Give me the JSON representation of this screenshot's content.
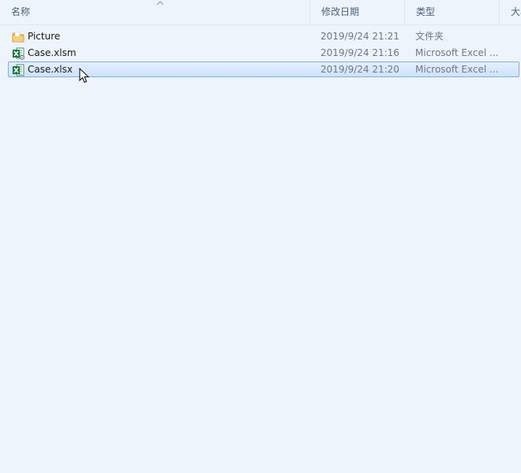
{
  "columns": {
    "name": "名称",
    "date": "修改日期",
    "type": "类型",
    "size": "大小"
  },
  "files": [
    {
      "name": "Picture",
      "date": "2019/9/24 21:21",
      "type": "文件夹",
      "icon": "folder-icon",
      "selected": false
    },
    {
      "name": "Case.xlsm",
      "date": "2019/9/24 21:16",
      "type": "Microsoft Excel ...",
      "icon": "excel-macro-file-icon",
      "selected": false
    },
    {
      "name": "Case.xlsx",
      "date": "2019/9/24 21:20",
      "type": "Microsoft Excel ...",
      "icon": "excel-file-icon",
      "selected": true
    }
  ],
  "colors": {
    "background": "#eef4fb",
    "selection": "#cfe3fb",
    "selection_border": "#84acdd",
    "excel_green": "#1e7145",
    "folder_yellow": "#e8b84a"
  }
}
